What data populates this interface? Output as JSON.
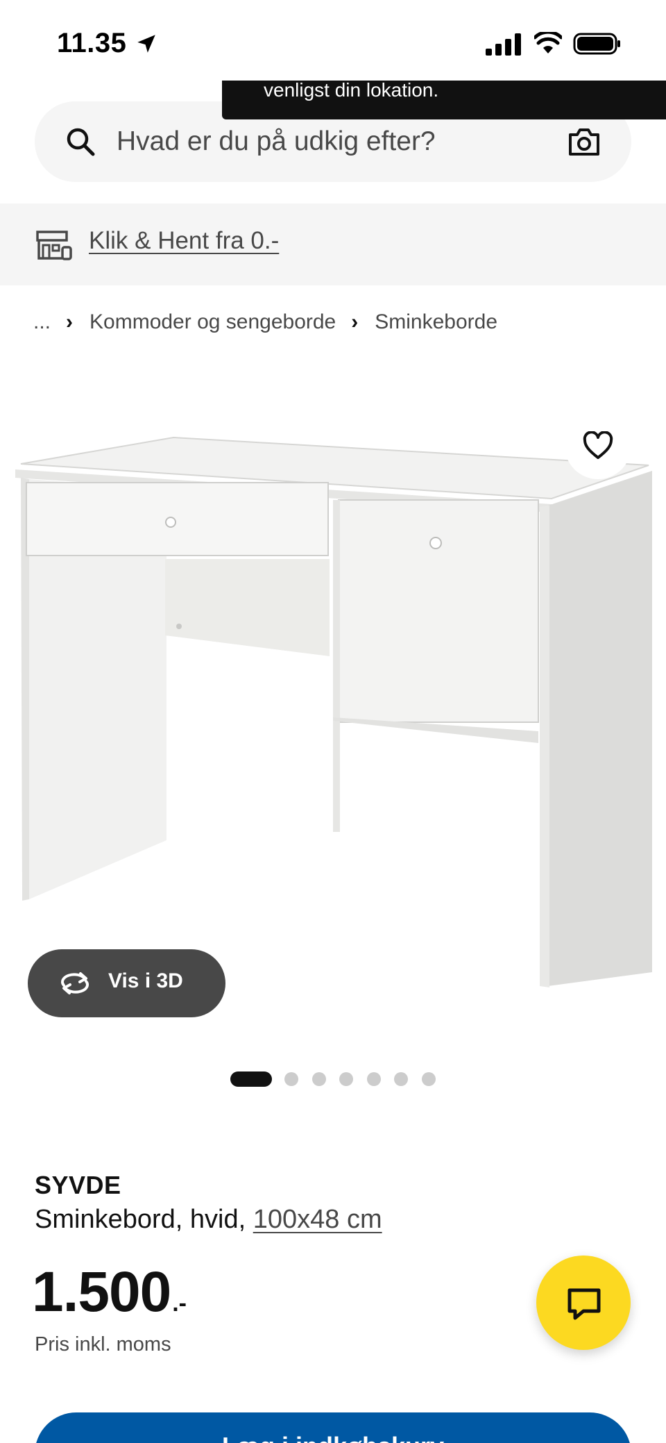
{
  "status_bar": {
    "time": "11.35",
    "icons": [
      "location-arrow-icon",
      "cellular-signal-icon",
      "wifi-icon",
      "battery-icon"
    ]
  },
  "toast": {
    "text": "venligst din lokation."
  },
  "search": {
    "placeholder": "Hvad er du på udkig efter?",
    "value": "",
    "icons": [
      "search-icon",
      "camera-icon"
    ]
  },
  "click_collect": {
    "link_text": "Klik & Hent fra 0.-",
    "icon": "store-icon"
  },
  "breadcrumb": {
    "ellipsis": "...",
    "separator": "›",
    "items": [
      "Kommoder og sengeborde",
      "Sminkeborde"
    ]
  },
  "gallery": {
    "view_3d_label": "Vis i 3D",
    "total_images": 7,
    "active_index": 0,
    "icons": [
      "heart-icon",
      "rotate-3d-icon"
    ]
  },
  "product": {
    "name": "SYVDE",
    "description": "Sminkebord, hvid, ",
    "size_link": "100x48 cm",
    "price_integer": "1.500",
    "price_suffix": ".-",
    "price_note": "Pris inkl. moms"
  },
  "chat": {
    "icon": "chat-bubble-icon"
  },
  "cart": {
    "label": "Læg i indkøbskurv"
  },
  "colors": {
    "search_bg": "#f5f5f5",
    "banner_bg": "#f5f5f5",
    "toast_bg": "#111111",
    "view3d_bg": "#484848",
    "chat_bg": "#fcd921",
    "cart_bg": "#0058a3",
    "dot_active": "#111111",
    "dot_inactive": "#cccccc"
  }
}
